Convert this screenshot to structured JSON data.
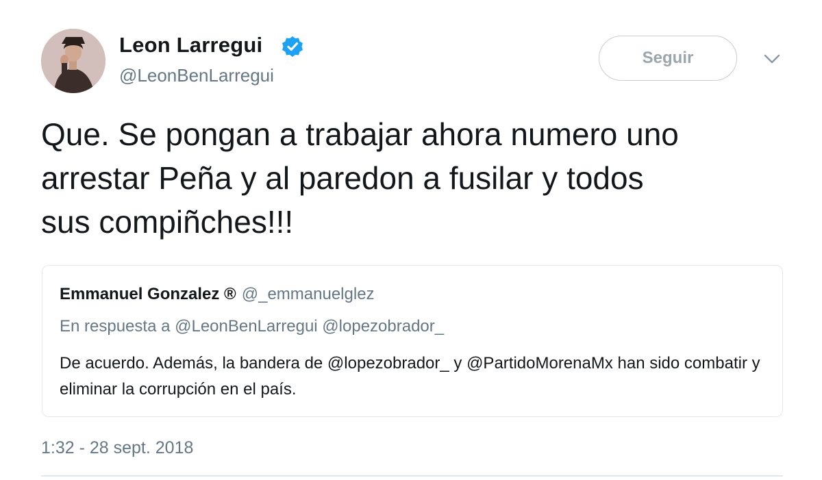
{
  "tweet": {
    "author": {
      "display_name": "Leon Larregui",
      "handle": "@LeonBenLarregui",
      "verified": true
    },
    "follow_label": "Seguir",
    "caret_icon": "chevron-down-icon",
    "text": "Que. Se pongan a trabajar ahora numero uno\narrestar Peña y al paredon a fusilar y  todos\nsus compiñches!!!",
    "timestamp": "1:32 - 28 sept. 2018"
  },
  "quoted": {
    "display_name": "Emmanuel Gonzalez ®",
    "handle": "@_emmanuelglez",
    "reply_prefix": "En respuesta a",
    "reply_to": [
      "@LeonBenLarregui",
      "@lopezobrador_"
    ],
    "text": "De acuerdo. Además, la bandera de @lopezobrador_ y @PartidoMorenaMx han sido combatir y eliminar la corrupción en el país."
  },
  "colors": {
    "text_primary": "#14171a",
    "text_secondary": "#657786",
    "verified_blue": "#1da1f2",
    "border": "#e1e8ed",
    "button_text": "#9aa5ad"
  }
}
